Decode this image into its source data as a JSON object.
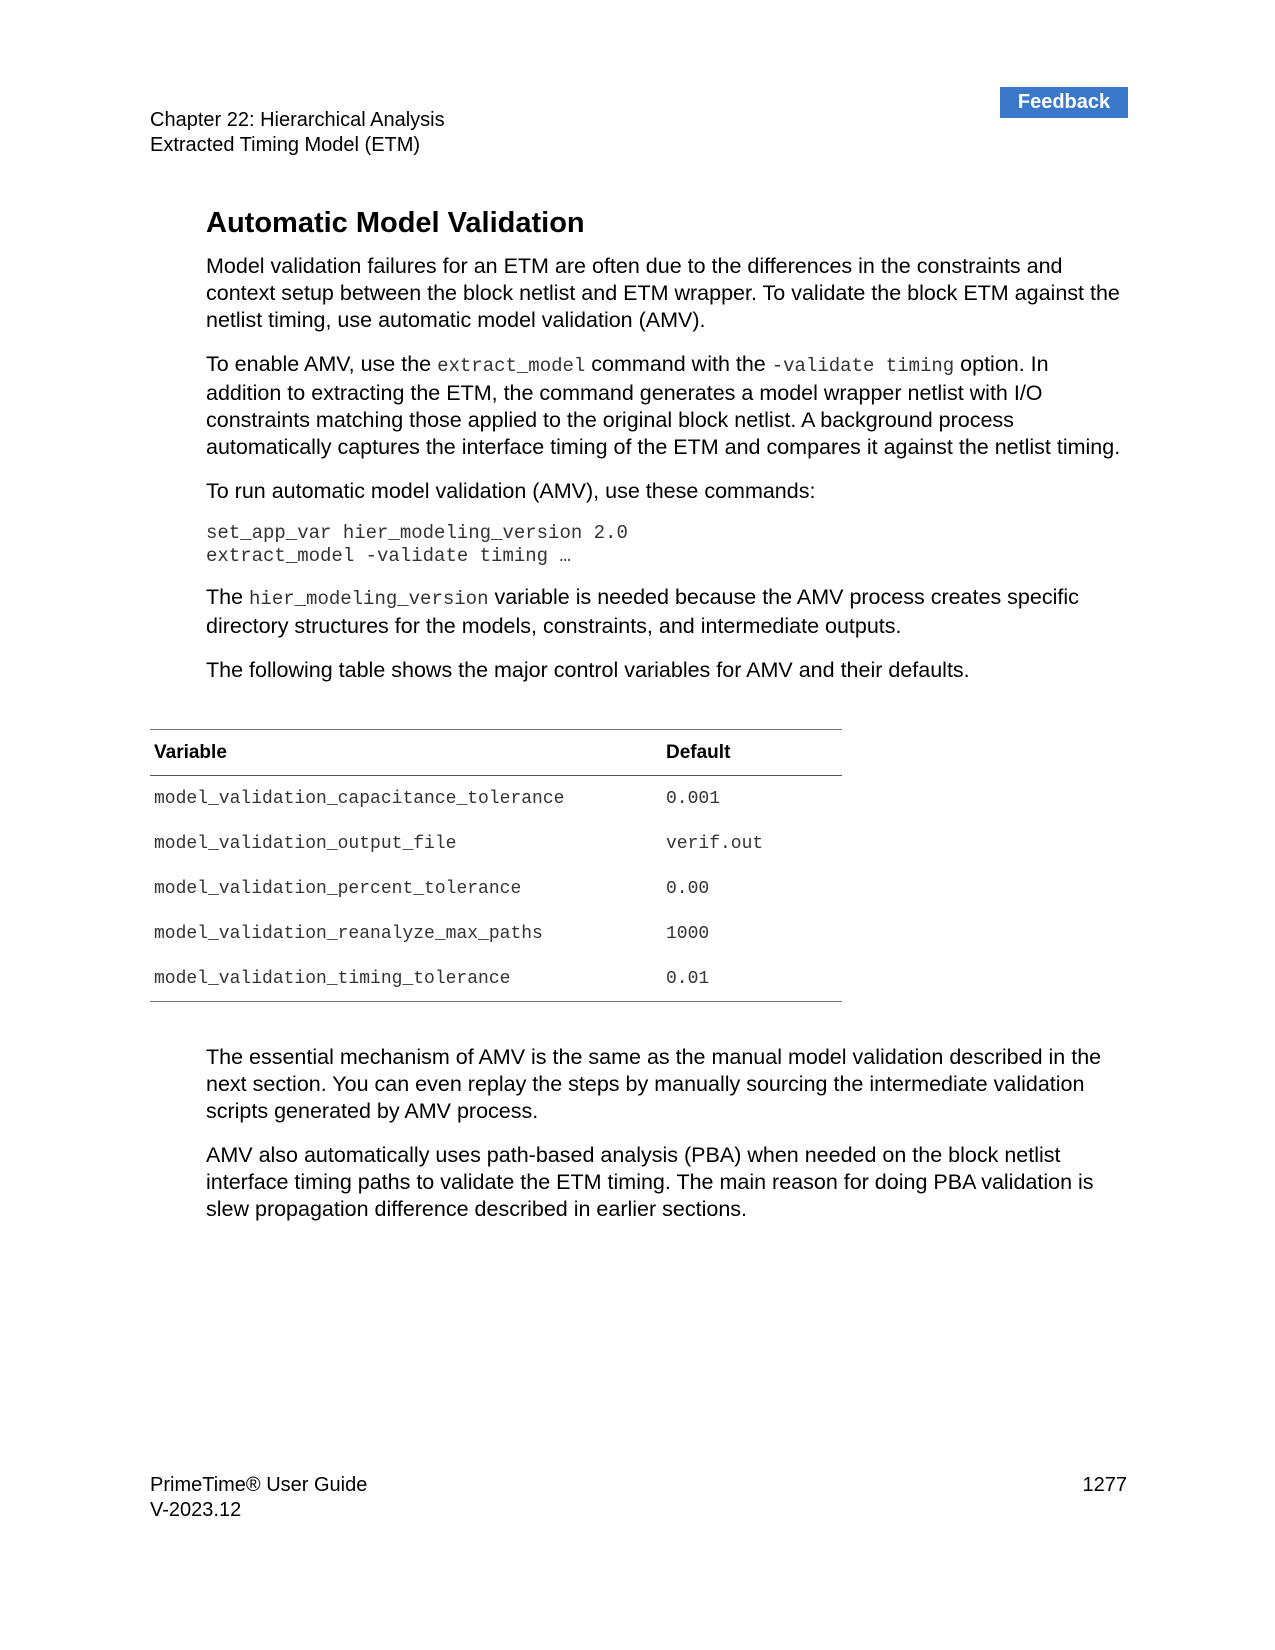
{
  "feedback_label": "Feedback",
  "header": {
    "chapter": "Chapter 22: Hierarchical Analysis",
    "section": "Extracted Timing Model (ETM)"
  },
  "title": "Automatic Model Validation",
  "p1": "Model validation failures for an ETM are often due to the differences in the constraints and context setup between the block netlist and ETM wrapper. To validate the block ETM against the netlist timing, use automatic model validation (AMV).",
  "p2": {
    "a": "To enable AMV, use the ",
    "code1": "extract_model",
    "b": " command with the ",
    "code2": "-validate timing",
    "c": " option. In addition to extracting the ETM, the command generates a model wrapper netlist with I/O constraints matching those applied to the original block netlist. A background process automatically captures the interface timing of the ETM and compares it against the netlist timing."
  },
  "p3": "To run automatic model validation (AMV), use these commands:",
  "code_lines": [
    "set_app_var hier_modeling_version 2.0",
    "extract_model -validate timing …"
  ],
  "p4": {
    "a": "The ",
    "code": "hier_modeling_version",
    "b": " variable is needed because the AMV process creates specific directory structures for the models, constraints, and intermediate outputs."
  },
  "p5": "The following table shows the major control variables for AMV and their defaults.",
  "table": {
    "headers": [
      "Variable",
      "Default"
    ],
    "rows": [
      [
        "model_validation_capacitance_tolerance",
        "0.001"
      ],
      [
        "model_validation_output_file",
        "verif.out"
      ],
      [
        "model_validation_percent_tolerance",
        "0.00"
      ],
      [
        "model_validation_reanalyze_max_paths",
        "1000"
      ],
      [
        "model_validation_timing_tolerance",
        "0.01"
      ]
    ]
  },
  "p6": "The essential mechanism of AMV is the same as the manual model validation described in the next section. You can even replay the steps by manually sourcing the intermediate validation scripts generated by AMV process.",
  "p7": "AMV also automatically uses path-based analysis (PBA) when needed on the block netlist interface timing paths to validate the ETM timing. The main reason for doing PBA validation is slew propagation difference described in earlier sections.",
  "footer": {
    "product": "PrimeTime® User Guide",
    "version": "V-2023.12",
    "page_number": "1277"
  }
}
